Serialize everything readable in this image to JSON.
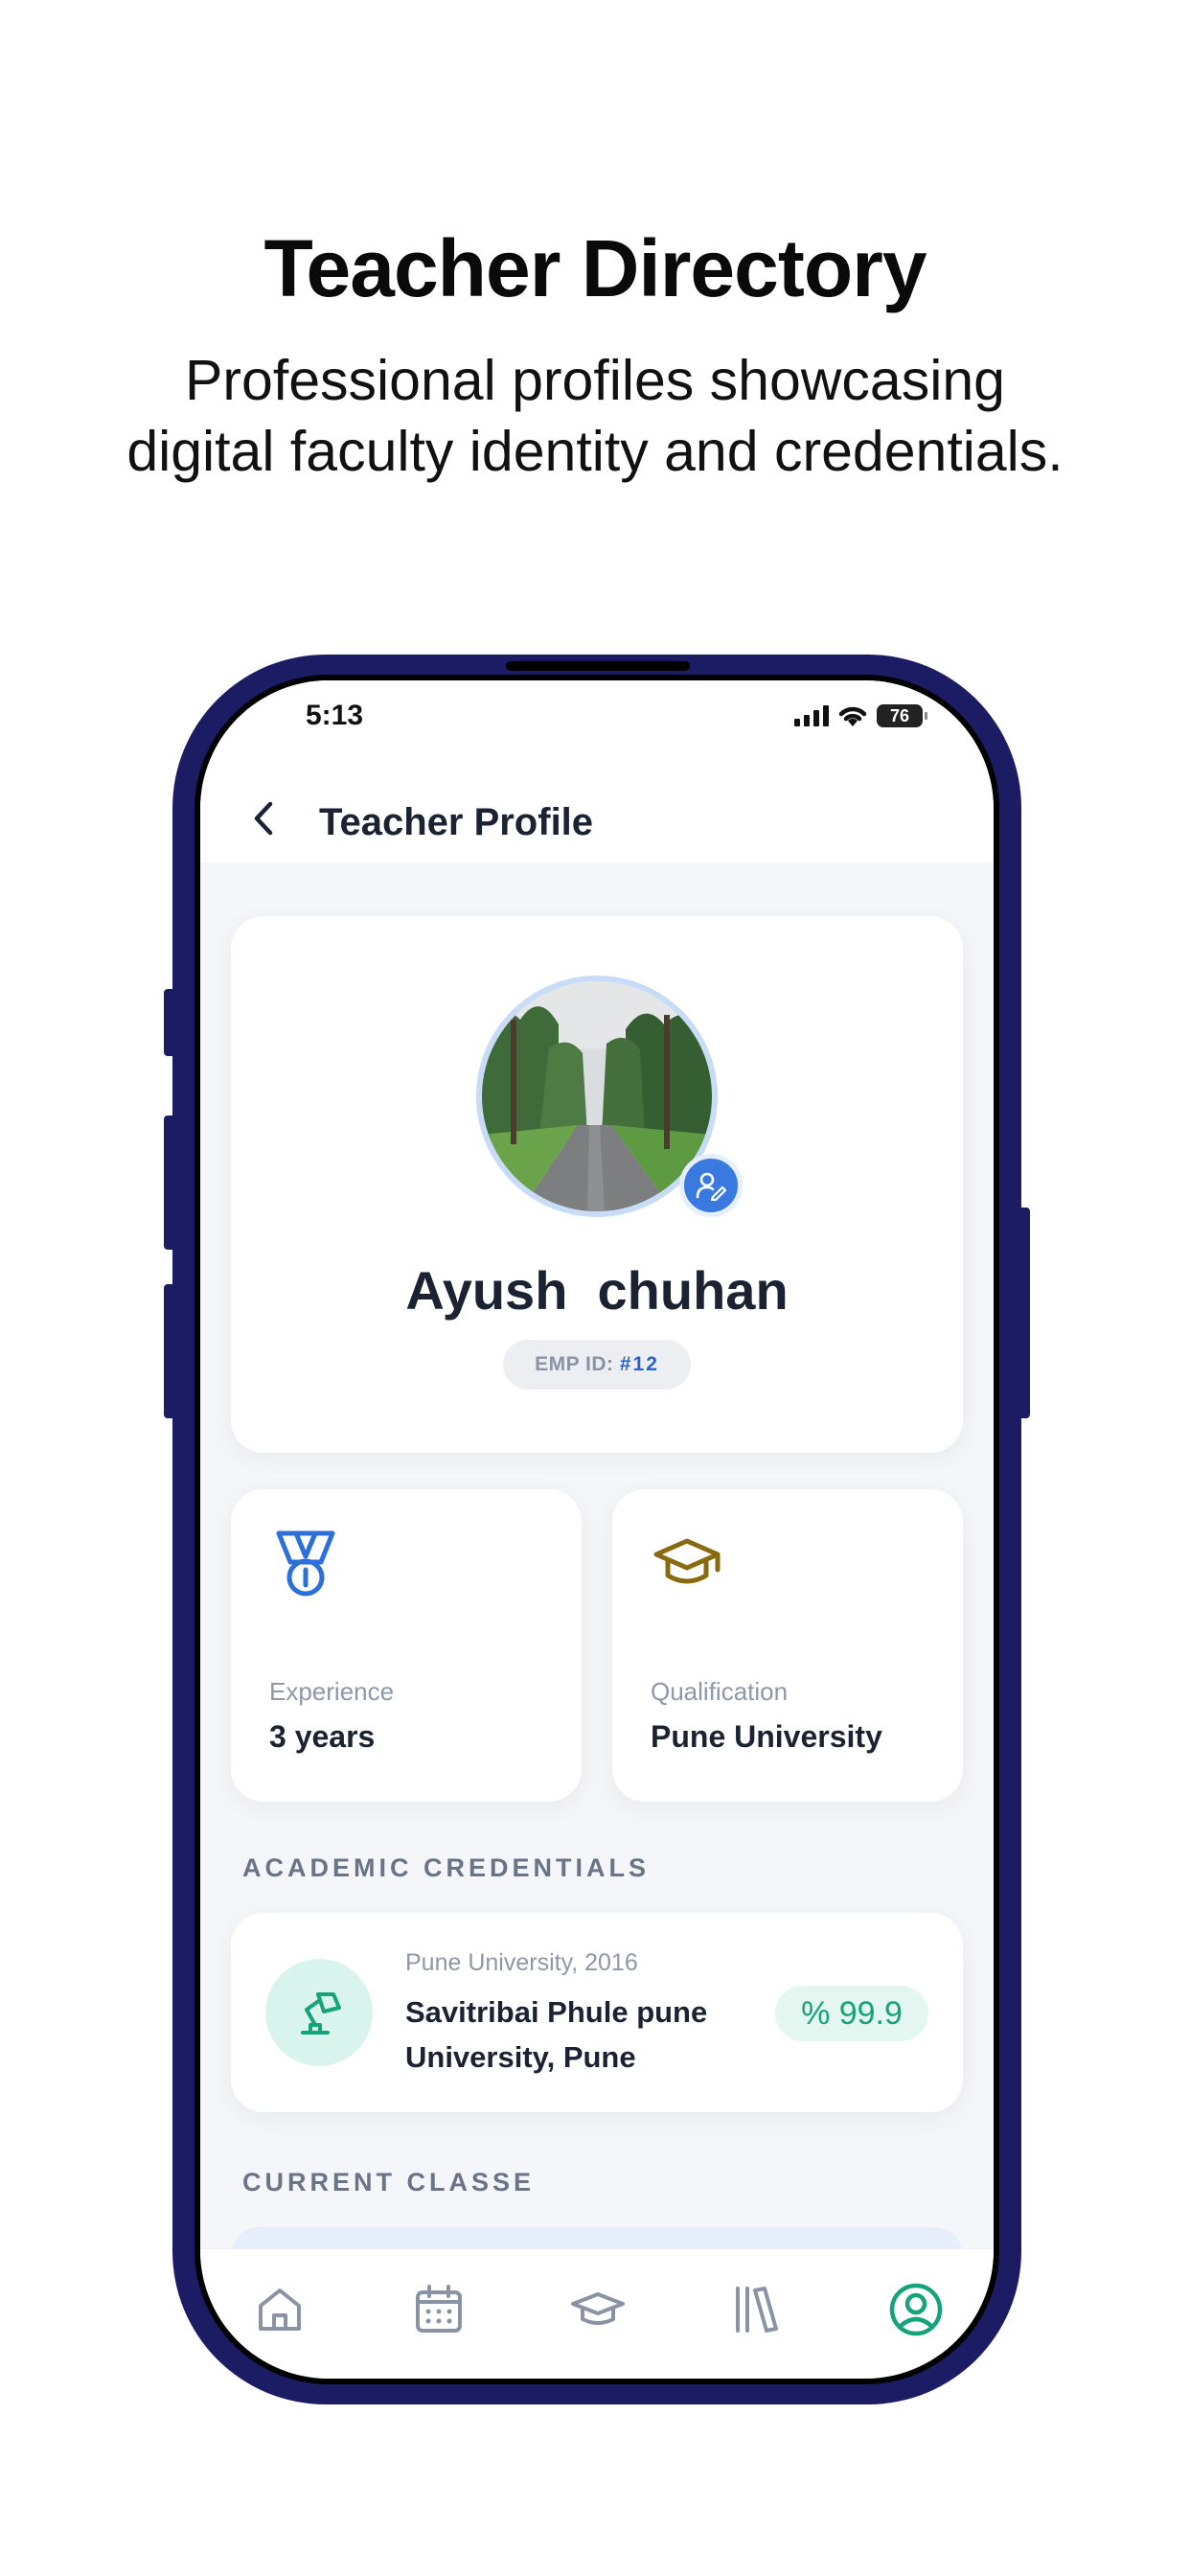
{
  "hero": {
    "title": "Teacher Directory",
    "subtitle": "Professional profiles showcasing digital faculty identity and credentials."
  },
  "status_bar": {
    "time": "5:13",
    "battery": "76"
  },
  "app_bar": {
    "title": "Teacher Profile",
    "back_icon": "chevron-left-icon"
  },
  "profile": {
    "name": "Ayush  chuhan",
    "emp_id_label": "EMP ID: ",
    "emp_id_value": "#12",
    "edit_icon": "user-edit-icon"
  },
  "stats": [
    {
      "icon": "medal-icon",
      "label": "Experience",
      "value": "3 years",
      "color": "#2b6fd9"
    },
    {
      "icon": "graduation-cap-icon",
      "label": "Qualification",
      "value": "Pune University",
      "color": "#8a6a10"
    }
  ],
  "sections": {
    "academic": "ACADEMIC CREDENTIALS",
    "current": "CURRENT CLASSE"
  },
  "credentials": [
    {
      "icon": "desk-lamp-icon",
      "subtitle": "Pune University, 2016",
      "title": "Savitribai Phule pune University, Pune",
      "score": "% 99.9"
    }
  ],
  "bottom_nav": [
    {
      "icon": "home-icon",
      "active": false
    },
    {
      "icon": "calendar-icon",
      "active": false
    },
    {
      "icon": "graduation-cap-icon",
      "active": false
    },
    {
      "icon": "library-icon",
      "active": false
    },
    {
      "icon": "profile-icon",
      "active": true
    }
  ],
  "colors": {
    "phone_frame": "#1c1c64",
    "accent_blue": "#3a7ae0",
    "accent_green": "#14a37a",
    "nav_inactive": "#8a93a3"
  }
}
